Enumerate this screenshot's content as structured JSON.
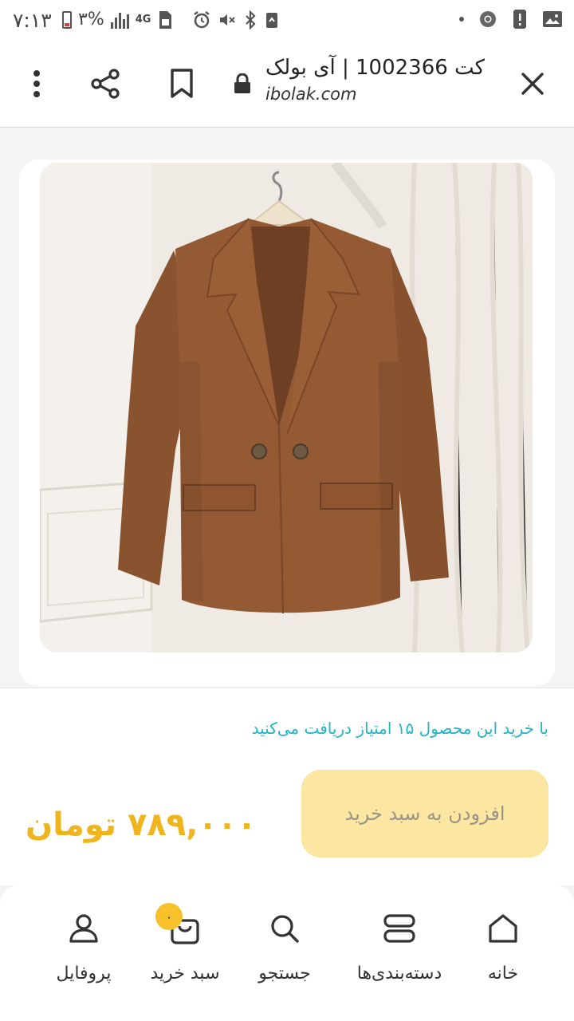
{
  "status_bar": {
    "time": "۷:۱۳",
    "battery_percent": "۳%",
    "network": "4G"
  },
  "toolbar": {
    "page_title": "کت 1002366 | آی بولک",
    "url_host": "ibolak.com"
  },
  "product": {
    "points_text": "با خرید این محصول ۱۵ امتیاز دریافت می‌کنید",
    "add_to_cart_label": "افزودن به سبد خرید",
    "price": "۷۸۹,۰۰۰ تومان"
  },
  "bottom_nav": {
    "items": [
      {
        "label": "خانه",
        "icon": "home-icon"
      },
      {
        "label": "دسته‌بندی‌ها",
        "icon": "categories-icon"
      },
      {
        "label": "جستجو",
        "icon": "search-icon"
      },
      {
        "label": "سبد خرید",
        "icon": "cart-icon",
        "badge": "۰"
      },
      {
        "label": "پروفایل",
        "icon": "profile-icon"
      }
    ]
  },
  "colors": {
    "accent_yellow": "#f0b41e",
    "button_bg": "#fbe7a1",
    "points_teal": "#20b4c9",
    "jacket_brown": "#8e552f"
  }
}
